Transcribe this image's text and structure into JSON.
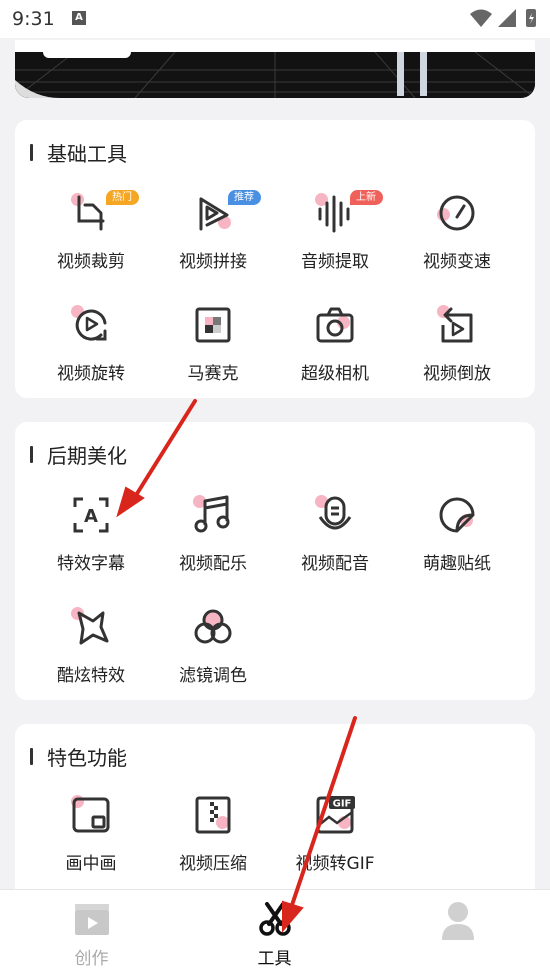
{
  "status": {
    "time": "9:31",
    "notification_icon": "A"
  },
  "sections": [
    {
      "title": "基础工具",
      "tools": [
        {
          "label": "视频裁剪",
          "icon": "crop-icon",
          "badge": "热门",
          "badge_color": "#f5a623"
        },
        {
          "label": "视频拼接",
          "icon": "splice-icon",
          "badge": "推荐",
          "badge_color": "#4a90e2"
        },
        {
          "label": "音频提取",
          "icon": "audio-wave-icon",
          "badge": "上新",
          "badge_color": "#f0605a"
        },
        {
          "label": "视频变速",
          "icon": "speedometer-icon"
        },
        {
          "label": "视频旋转",
          "icon": "rotate-icon"
        },
        {
          "label": "马赛克",
          "icon": "mosaic-icon"
        },
        {
          "label": "超级相机",
          "icon": "camera-icon"
        },
        {
          "label": "视频倒放",
          "icon": "reverse-icon"
        }
      ]
    },
    {
      "title": "后期美化",
      "tools": [
        {
          "label": "特效字幕",
          "icon": "subtitle-icon"
        },
        {
          "label": "视频配乐",
          "icon": "music-note-icon"
        },
        {
          "label": "视频配音",
          "icon": "microphone-icon"
        },
        {
          "label": "萌趣贴纸",
          "icon": "sticker-icon"
        },
        {
          "label": "酷炫特效",
          "icon": "star-effect-icon"
        },
        {
          "label": "滤镜调色",
          "icon": "filter-icon"
        }
      ]
    },
    {
      "title": "特色功能",
      "tools": [
        {
          "label": "画中画",
          "icon": "picture-in-picture-icon"
        },
        {
          "label": "视频压缩",
          "icon": "compress-icon"
        },
        {
          "label": "视频转GIF",
          "icon": "gif-icon",
          "gif_text": "GIF"
        }
      ]
    }
  ],
  "tabbar": [
    {
      "label": "创作",
      "icon": "clapperboard-icon",
      "active": false
    },
    {
      "label": "工具",
      "icon": "scissors-icon",
      "active": true
    },
    {
      "label": "",
      "icon": "profile-icon",
      "active": false
    }
  ],
  "colors": {
    "accent": "#222222",
    "inactive": "#bdbdbd",
    "pink_dot": "#f7b4c2",
    "arrow": "#d9261c"
  }
}
